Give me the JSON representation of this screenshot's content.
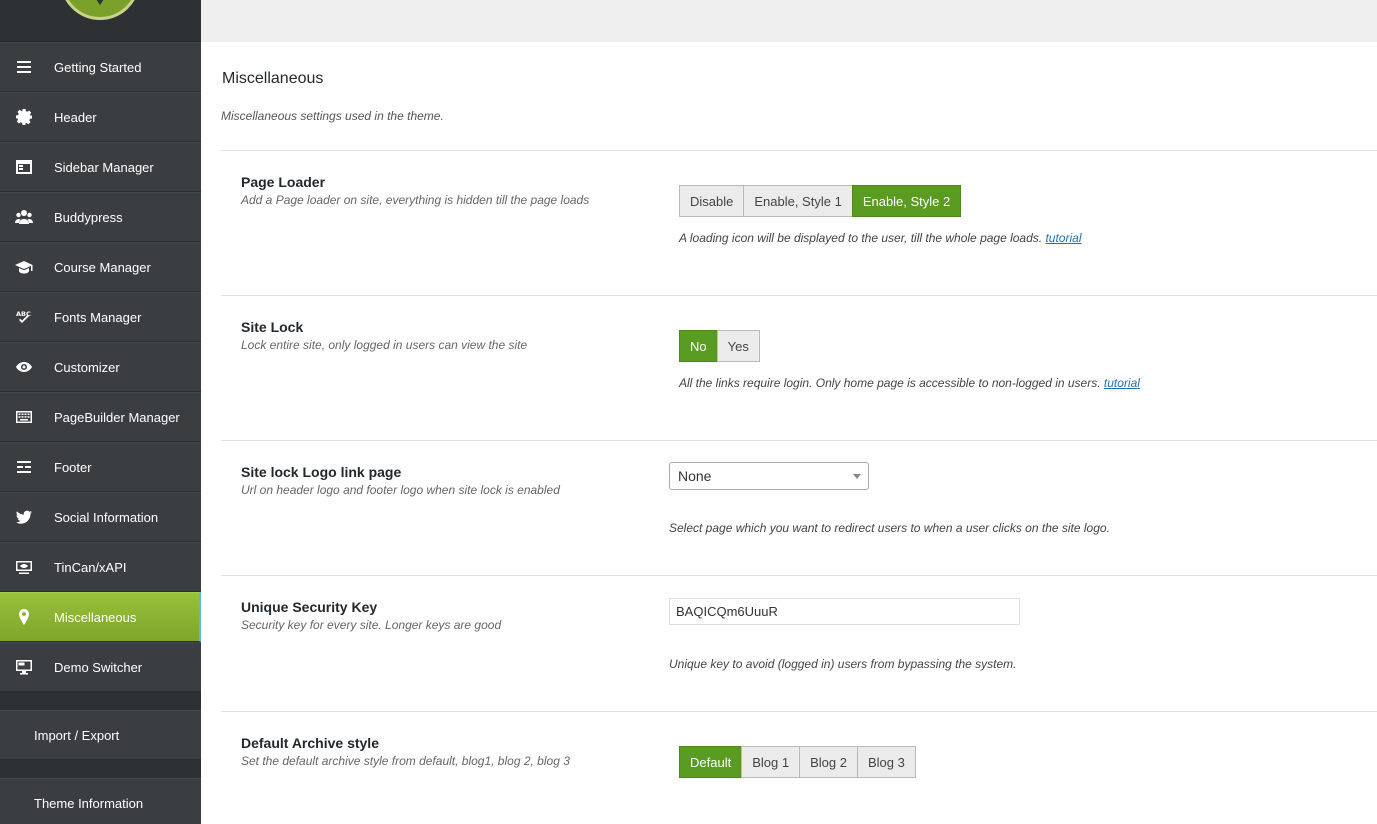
{
  "sidebar": {
    "items": [
      {
        "label": "Getting Started",
        "icon": "menu-icon"
      },
      {
        "label": "Header",
        "icon": "gear-icon"
      },
      {
        "label": "Sidebar Manager",
        "icon": "sidebar-icon"
      },
      {
        "label": "Buddypress",
        "icon": "group-icon"
      },
      {
        "label": "Course Manager",
        "icon": "graduation-cap-icon"
      },
      {
        "label": "Fonts Manager",
        "icon": "spellcheck-icon"
      },
      {
        "label": "Customizer",
        "icon": "eye-icon"
      },
      {
        "label": "PageBuilder Manager",
        "icon": "keyboard-icon"
      },
      {
        "label": "Footer",
        "icon": "footer-icon"
      },
      {
        "label": "Social Information",
        "icon": "twitter-icon"
      },
      {
        "label": "TinCan/xAPI",
        "icon": "screen-eye-icon"
      },
      {
        "label": "Miscellaneous",
        "icon": "map-pin-icon",
        "active": true
      },
      {
        "label": "Demo Switcher",
        "icon": "monitor-icon"
      }
    ],
    "import_export": "Import / Export",
    "theme_information": "Theme Information"
  },
  "main": {
    "title": "Miscellaneous",
    "description": "Miscellaneous settings used in the theme.",
    "page_loader": {
      "label": "Page Loader",
      "sub": "Add a Page loader on site, everything is hidden till the page loads",
      "options": [
        "Disable",
        "Enable, Style 1",
        "Enable, Style 2"
      ],
      "selected": "Enable, Style 2",
      "note": "A loading icon will be displayed to the user, till the whole page loads.",
      "link": "tutorial"
    },
    "site_lock": {
      "label": "Site Lock",
      "sub": "Lock entire site, only logged in users can view the site",
      "options": [
        "No",
        "Yes"
      ],
      "selected": "No",
      "note": "All the links require login. Only home page is accessible to non-logged in users.",
      "link": "tutorial"
    },
    "site_lock_logo": {
      "label": "Site lock Logo link page",
      "sub": "Url on header logo and footer logo when site lock is enabled",
      "value": "None",
      "note": "Select page which you want to redirect users to when a user clicks on the site logo."
    },
    "security_key": {
      "label": "Unique Security Key",
      "sub": "Security key for every site. Longer keys are good",
      "value": "BAQICQm6UuuR",
      "note": "Unique key to avoid (logged in) users from bypassing the system."
    },
    "archive_style": {
      "label": "Default Archive style",
      "sub": "Set the default archive style from default, blog1, blog 2, blog 3",
      "options": [
        "Default",
        "Blog 1",
        "Blog 2",
        "Blog 3"
      ],
      "selected": "Default"
    }
  },
  "colors": {
    "sidebar_bg": "#3a3e41",
    "active_green": "#8db533",
    "button_selected": "#5a9b21",
    "link": "#2271b1"
  }
}
